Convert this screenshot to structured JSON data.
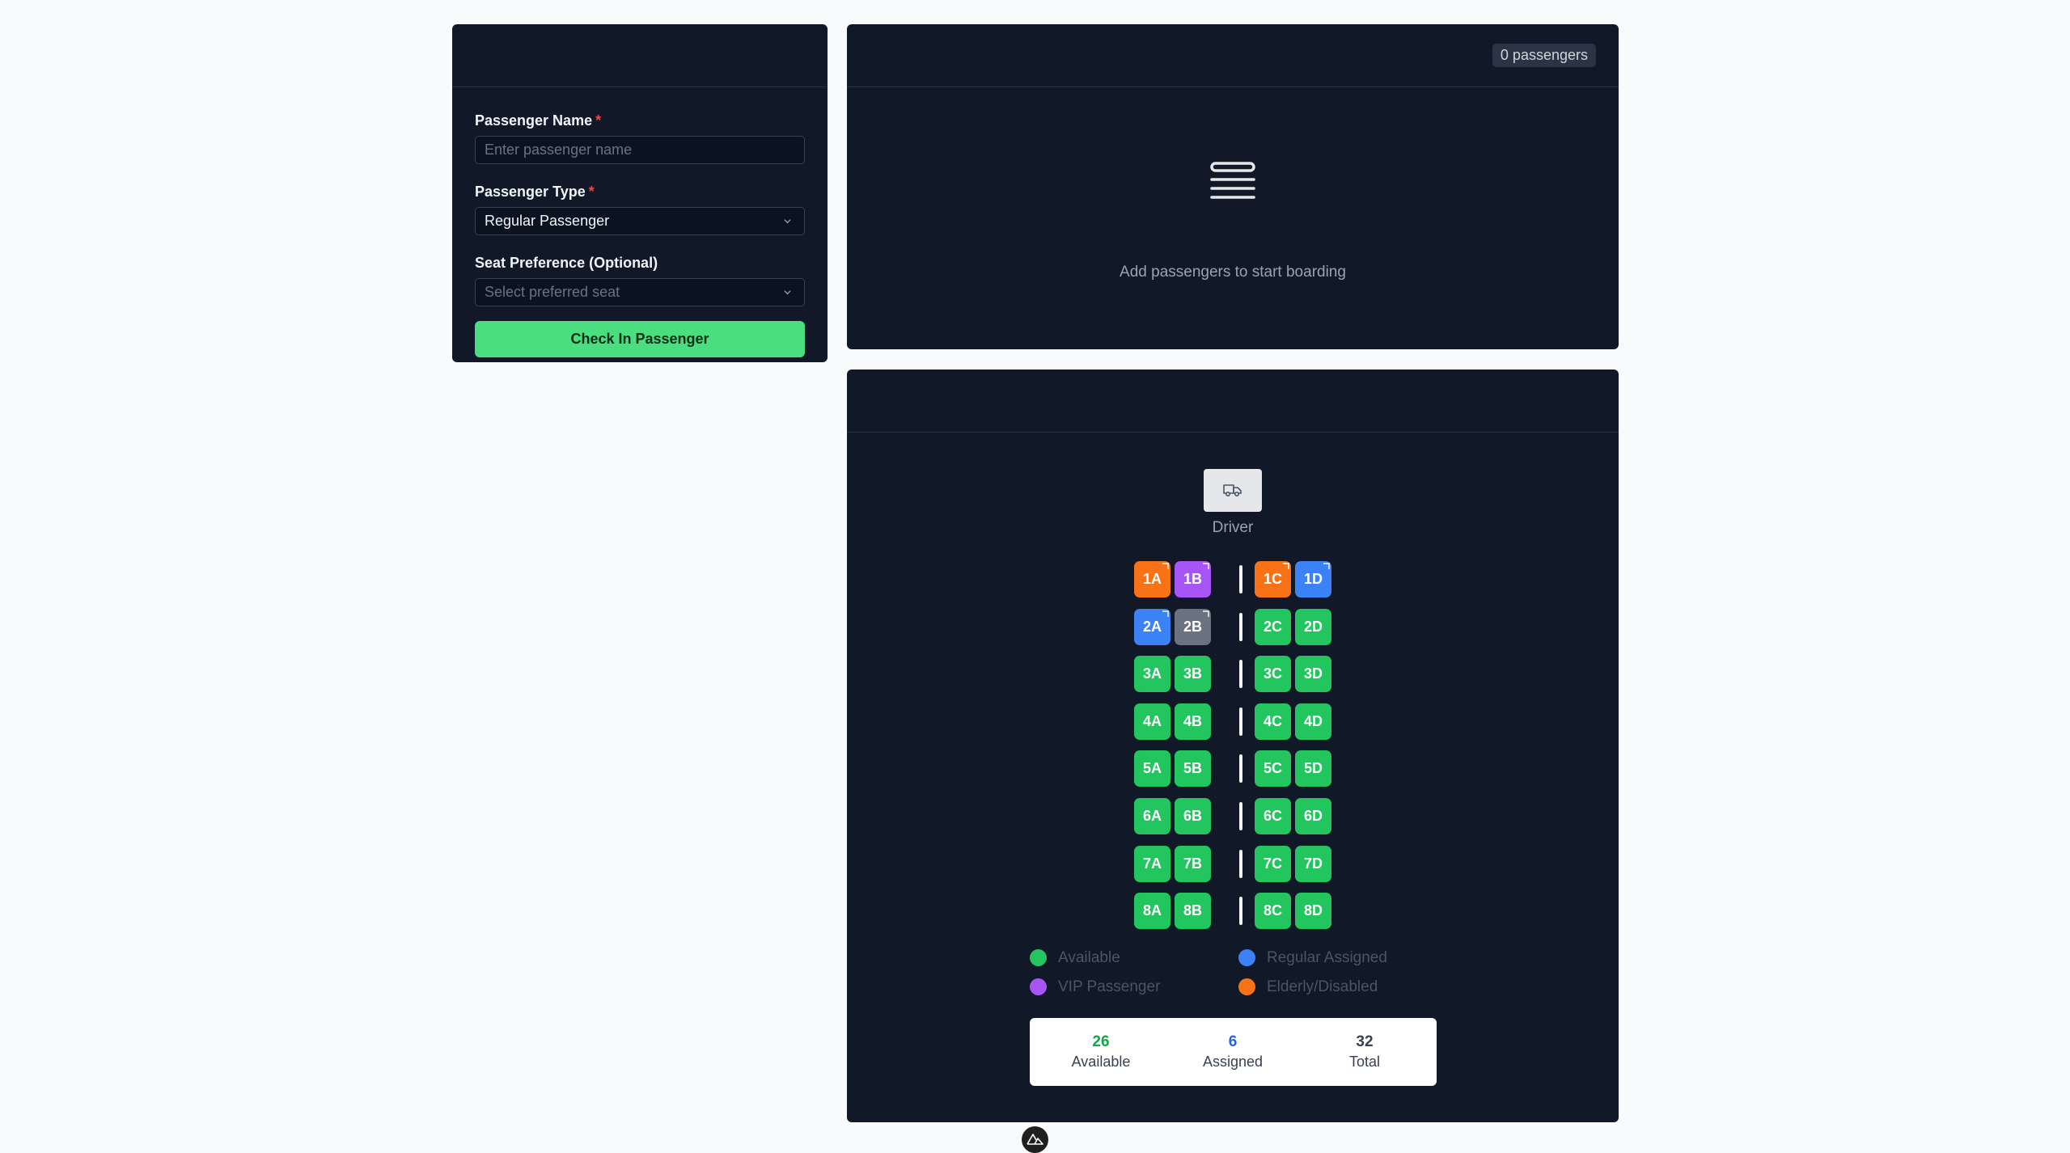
{
  "form": {
    "name_label": "Passenger Name",
    "required_mark": "*",
    "name_placeholder": "Enter passenger name",
    "type_label": "Passenger Type",
    "type_value": "Regular Passenger",
    "pref_label": "Seat Preference (Optional)",
    "pref_placeholder": "Select preferred seat",
    "checkin_label": "Check In Passenger"
  },
  "queue": {
    "count_badge": "0 passengers",
    "empty_message": "Add passengers to start boarding"
  },
  "seatmap": {
    "driver_label": "Driver",
    "rows": [
      {
        "A": "1A",
        "B": "1B",
        "C": "1C",
        "D": "1D"
      },
      {
        "A": "2A",
        "B": "2B",
        "C": "2C",
        "D": "2D"
      },
      {
        "A": "3A",
        "B": "3B",
        "C": "3C",
        "D": "3D"
      },
      {
        "A": "4A",
        "B": "4B",
        "C": "4C",
        "D": "4D"
      },
      {
        "A": "5A",
        "B": "5B",
        "C": "5C",
        "D": "5D"
      },
      {
        "A": "6A",
        "B": "6B",
        "C": "6C",
        "D": "6D"
      },
      {
        "A": "7A",
        "B": "7B",
        "C": "7C",
        "D": "7D"
      },
      {
        "A": "8A",
        "B": "8B",
        "C": "8C",
        "D": "8D"
      }
    ],
    "seat_status": {
      "1A": "elderly",
      "1B": "vip",
      "1C": "elderly",
      "1D": "regular",
      "2A": "regular",
      "2B": "gray"
    },
    "legend": {
      "available": "Available",
      "regular": "Regular Assigned",
      "vip": "VIP Passenger",
      "elderly": "Elderly/Disabled"
    },
    "stats": {
      "available_count": "26",
      "available_label": "Available",
      "assigned_count": "6",
      "assigned_label": "Assigned",
      "total_count": "32",
      "total_label": "Total"
    }
  },
  "colors": {
    "available": "#22c55e",
    "regular": "#3b82f6",
    "vip": "#a855f7",
    "elderly": "#f97316",
    "gray": "#6b7280",
    "primary_button": "#4ade80",
    "panel_bg": "#111827"
  },
  "icons": {
    "empty_state": "list-lines-icon",
    "driver": "truck-icon",
    "select_chevron": "chevron-down-icon",
    "bottom_logo": "nuxt-logo-icon"
  }
}
